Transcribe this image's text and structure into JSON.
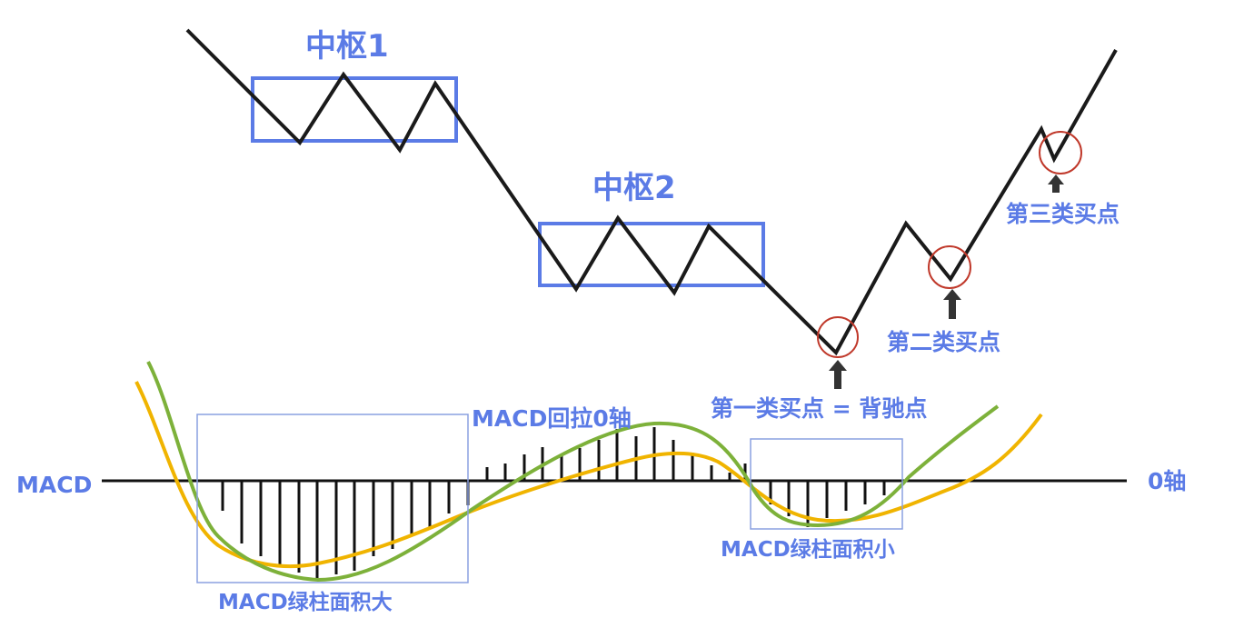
{
  "labels": {
    "zone1": "中枢1",
    "zone2": "中枢2",
    "buy1": "第一类买点 = 背驰点",
    "buy2": "第二类买点",
    "buy3": "第三类买点",
    "macd": "MACD",
    "zero_axis": "0轴",
    "pullback": "MACD回拉0轴",
    "green_large": "MACD绿柱面积大",
    "green_small": "MACD绿柱面积小"
  },
  "colors": {
    "price_line": "#1a1a1a",
    "zone_box": "#5b7be6",
    "label": "#5b7be6",
    "marker_circle": "#c0392b",
    "arrow": "#333333",
    "dif_line": "#7db13a",
    "dea_line": "#f0b400",
    "histogram": "#111111",
    "macd_box": "#8aa0e0"
  },
  "icons": {
    "buy_marker": "red-circle-icon",
    "buy_arrow": "up-arrow-icon"
  }
}
